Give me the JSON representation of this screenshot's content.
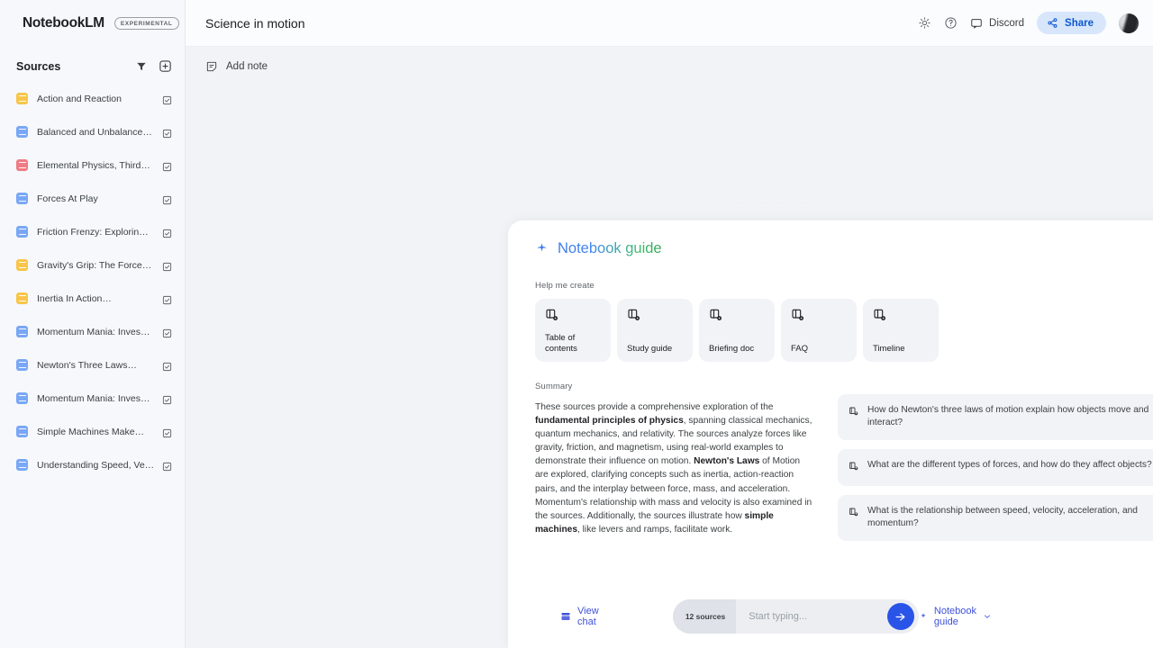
{
  "app": {
    "brand": "NotebookLM",
    "brand_badge": "EXPERIMENTAL",
    "menu_icon": "hamburger-menu-icon"
  },
  "sidebar": {
    "title": "Sources",
    "filter_icon": "filter-icon",
    "add_icon": "add-source-icon",
    "items": [
      {
        "label": "Action and Reaction",
        "icon": "doc-icon",
        "color": "#f7c54a",
        "checked": true
      },
      {
        "label": "Balanced and Unbalance…",
        "icon": "doc-icon",
        "color": "#7aa7f5",
        "checked": true
      },
      {
        "label": "Elemental Physics, Third…",
        "icon": "pdf-icon",
        "color": "#ef7b84",
        "checked": true
      },
      {
        "label": "Forces At Play",
        "icon": "doc-icon",
        "color": "#7aa7f5",
        "checked": true
      },
      {
        "label": "Friction Frenzy: Explorin…",
        "icon": "doc-icon",
        "color": "#7aa7f5",
        "checked": true
      },
      {
        "label": "Gravity's Grip: The Force…",
        "icon": "doc-icon",
        "color": "#f7c54a",
        "checked": true
      },
      {
        "label": "Inertia In Action…",
        "icon": "doc-icon",
        "color": "#f7c54a",
        "checked": true
      },
      {
        "label": "Momentum Mania: Inves…",
        "icon": "doc-icon",
        "color": "#7aa7f5",
        "checked": true
      },
      {
        "label": "Newton's Three Laws…",
        "icon": "doc-icon",
        "color": "#7aa7f5",
        "checked": true
      },
      {
        "label": "Momentum Mania: Inves…",
        "icon": "doc-icon",
        "color": "#7aa7f5",
        "checked": true
      },
      {
        "label": "Simple Machines Make…",
        "icon": "doc-icon",
        "color": "#7aa7f5",
        "checked": true
      },
      {
        "label": "Understanding Speed, Ve…",
        "icon": "doc-icon",
        "color": "#7aa7f5",
        "checked": true
      }
    ]
  },
  "header": {
    "notebook_title": "Science in motion",
    "brightness_icon": "brightness-icon",
    "help_icon": "help-circle-icon",
    "discord_icon": "discord-chat-icon",
    "discord_label": "Discord",
    "share_icon": "share-icon",
    "share_label": "Share",
    "avatar": "user-avatar"
  },
  "toolbar": {
    "add_note_icon": "add-note-icon",
    "add_note_label": "Add note"
  },
  "guide": {
    "spark_icon": "spark-icon",
    "title": "Notebook guide",
    "create_label": "Help me create",
    "create_cards": [
      {
        "label": "Table of contents",
        "icon": "document-generate-icon"
      },
      {
        "label": "Study guide",
        "icon": "document-generate-icon"
      },
      {
        "label": "Briefing doc",
        "icon": "document-generate-icon"
      },
      {
        "label": "FAQ",
        "icon": "document-generate-icon"
      },
      {
        "label": "Timeline",
        "icon": "document-generate-icon"
      }
    ],
    "summary_label": "Summary",
    "summary_parts": [
      {
        "t": "These sources provide a comprehensive exploration of the ",
        "b": false
      },
      {
        "t": "fundamental principles of physics",
        "b": true
      },
      {
        "t": ", spanning classical mechanics, quantum mechanics, and relativity. The sources analyze forces like gravity, friction, and magnetism, using real-world examples to demonstrate their influence on motion. ",
        "b": false
      },
      {
        "t": "Newton's Laws",
        "b": true
      },
      {
        "t": " of Motion are explored, clarifying concepts such as inertia, action-reaction pairs, and the interplay between force, mass, and acceleration. Momentum's relationship with mass and velocity is also examined in the sources. Additionally, the sources illustrate how ",
        "b": false
      },
      {
        "t": "simple machines",
        "b": true
      },
      {
        "t": ", like levers and ramps, facilitate work.",
        "b": false
      }
    ],
    "questions": [
      {
        "icon": "question-source-icon",
        "text": "How do Newton's three laws of motion explain how objects move and interact?"
      },
      {
        "icon": "question-source-icon",
        "text": "What are the different types of forces, and how do they affect objects?"
      },
      {
        "icon": "question-source-icon",
        "text": "What is the relationship between speed, velocity, acceleration, and momentum?"
      }
    ]
  },
  "composer": {
    "view_chat_icon": "view-chat-icon",
    "view_chat_label": "View chat",
    "sources_chip": "12 sources",
    "placeholder": "Start typing...",
    "value": "",
    "send_icon": "send-arrow-icon",
    "guide_toggle_icon": "spark-icon",
    "guide_toggle_label": "Notebook guide",
    "chevron_icon": "chevron-down-icon"
  },
  "colors": {
    "accent_blue": "#0b57d0",
    "send_blue": "#2a54e8",
    "link_indigo": "#3f51d8",
    "panel_bg": "#f1f3f6",
    "surface": "#ffffff"
  }
}
